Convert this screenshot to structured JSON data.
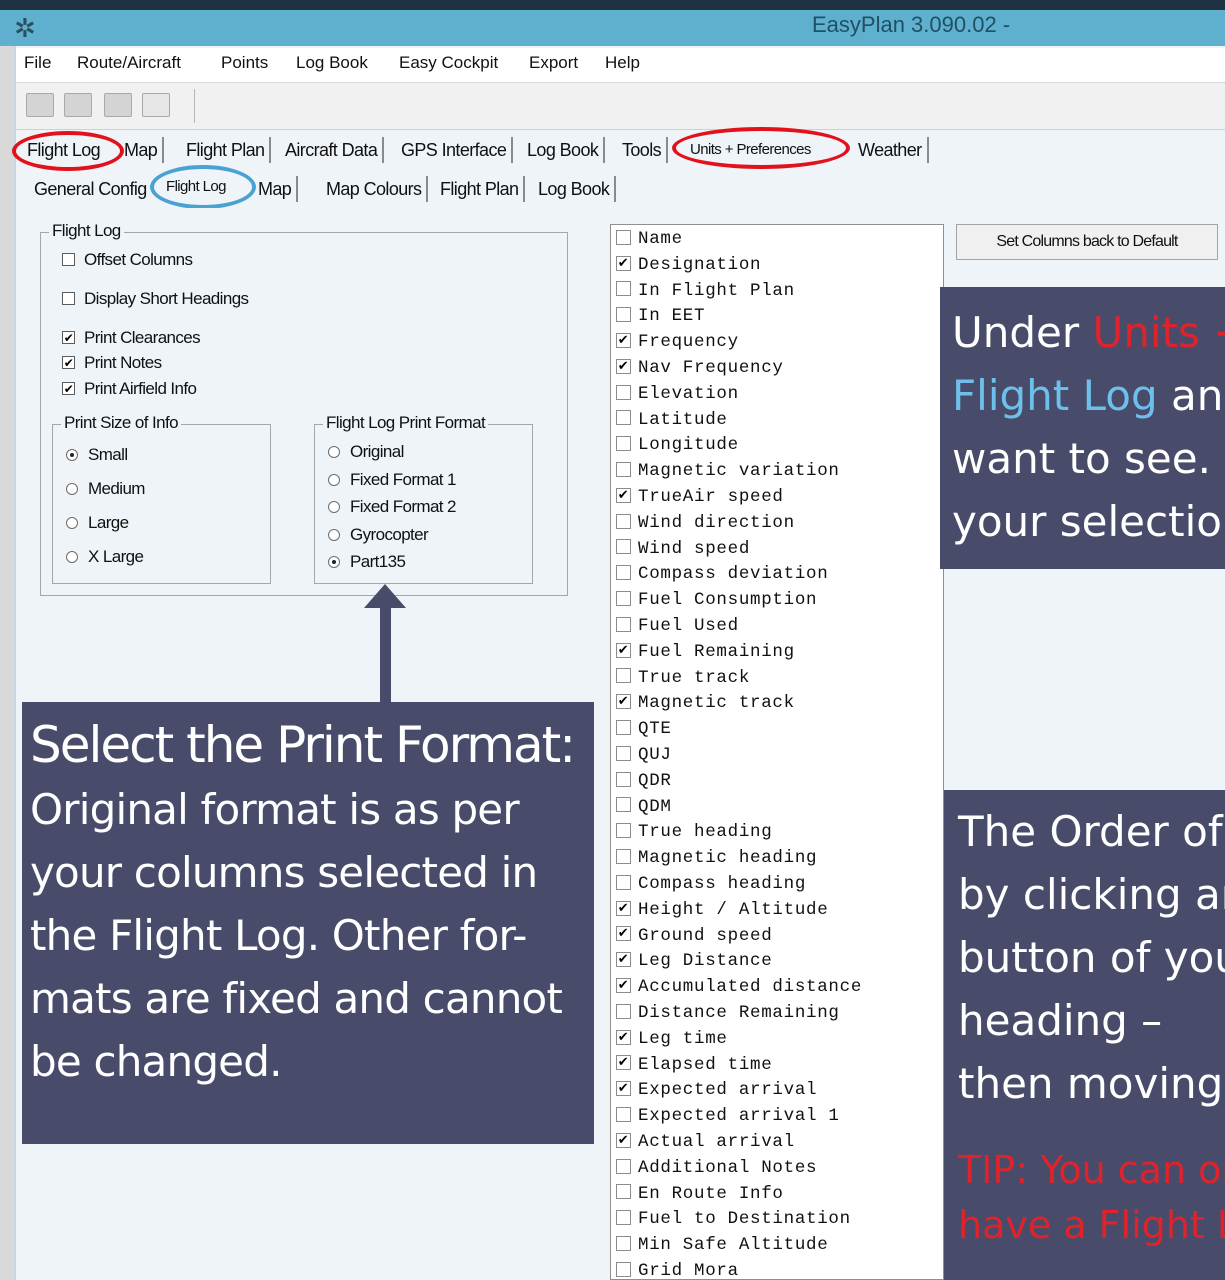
{
  "window": {
    "title": "EasyPlan 3.090.02 -",
    "icon": "easyplan-app-icon"
  },
  "menu": [
    "File",
    "Route/Aircraft",
    "Points",
    "Log Book",
    "Easy Cockpit",
    "Export",
    "Help"
  ],
  "toolbar": {
    "icons": [
      "open-icon",
      "save-icon",
      "print-icon",
      "print-preview-icon"
    ]
  },
  "main_tabs": [
    {
      "label": "Flight Log",
      "circled": "red"
    },
    {
      "label": "Map"
    },
    {
      "label": "Flight Plan"
    },
    {
      "label": "Aircraft Data"
    },
    {
      "label": "GPS Interface"
    },
    {
      "label": "Log Book"
    },
    {
      "label": "Tools"
    },
    {
      "label": "Units + Preferences",
      "circled": "red",
      "selected": true
    },
    {
      "label": "Weather"
    }
  ],
  "sub_tabs": [
    {
      "label": "General Config"
    },
    {
      "label": "Flight Log",
      "circled": "blue",
      "selected": true
    },
    {
      "label": "Map"
    },
    {
      "label": "Map Colours"
    },
    {
      "label": "Flight Plan"
    },
    {
      "label": "Log Book"
    }
  ],
  "flight_log_group": {
    "title": "Flight Log",
    "options": [
      {
        "label": "Offset Columns",
        "checked": false
      },
      {
        "label": "Display Short Headings",
        "checked": false
      },
      {
        "label": "Print Clearances",
        "checked": true
      },
      {
        "label": "Print Notes",
        "checked": true
      },
      {
        "label": "Print Airfield Info",
        "checked": true
      }
    ]
  },
  "print_size": {
    "title": "Print Size of Info",
    "options": [
      {
        "label": "Small",
        "selected": true
      },
      {
        "label": "Medium",
        "selected": false
      },
      {
        "label": "Large",
        "selected": false
      },
      {
        "label": "X Large",
        "selected": false
      }
    ]
  },
  "print_format": {
    "title": "Flight Log Print Format",
    "options": [
      {
        "label": "Original",
        "selected": false
      },
      {
        "label": "Fixed Format 1",
        "selected": false
      },
      {
        "label": "Fixed Format 2",
        "selected": false
      },
      {
        "label": "Gyrocopter",
        "selected": false
      },
      {
        "label": "Part135",
        "selected": true
      }
    ]
  },
  "columns": [
    {
      "label": "Name",
      "checked": false
    },
    {
      "label": "Designation",
      "checked": true
    },
    {
      "label": "In Flight Plan",
      "checked": false
    },
    {
      "label": "In EET",
      "checked": false
    },
    {
      "label": "Frequency",
      "checked": true
    },
    {
      "label": "Nav Frequency",
      "checked": true
    },
    {
      "label": "Elevation",
      "checked": false
    },
    {
      "label": "Latitude",
      "checked": false
    },
    {
      "label": "Longitude",
      "checked": false
    },
    {
      "label": "Magnetic variation",
      "checked": false
    },
    {
      "label": "TrueAir speed",
      "checked": true
    },
    {
      "label": "Wind direction",
      "checked": false
    },
    {
      "label": "Wind speed",
      "checked": false
    },
    {
      "label": "Compass deviation",
      "checked": false
    },
    {
      "label": "Fuel Consumption",
      "checked": false
    },
    {
      "label": "Fuel Used",
      "checked": false
    },
    {
      "label": "Fuel Remaining",
      "checked": true
    },
    {
      "label": "True track",
      "checked": false
    },
    {
      "label": "Magnetic track",
      "checked": true
    },
    {
      "label": "QTE",
      "checked": false
    },
    {
      "label": "QUJ",
      "checked": false
    },
    {
      "label": "QDR",
      "checked": false
    },
    {
      "label": "QDM",
      "checked": false
    },
    {
      "label": "True heading",
      "checked": false
    },
    {
      "label": "Magnetic heading",
      "checked": false
    },
    {
      "label": "Compass heading",
      "checked": false
    },
    {
      "label": "Height / Altitude",
      "checked": true
    },
    {
      "label": "Ground speed",
      "checked": true
    },
    {
      "label": "Leg Distance",
      "checked": true
    },
    {
      "label": "Accumulated distance",
      "checked": true
    },
    {
      "label": "Distance Remaining",
      "checked": false
    },
    {
      "label": "Leg time",
      "checked": true
    },
    {
      "label": "Elapsed time",
      "checked": true
    },
    {
      "label": "Expected arrival",
      "checked": true
    },
    {
      "label": "Expected arrival 1",
      "checked": false
    },
    {
      "label": "Actual arrival",
      "checked": true
    },
    {
      "label": "Additional Notes",
      "checked": false
    },
    {
      "label": "En Route Info",
      "checked": false
    },
    {
      "label": "Fuel to Destination",
      "checked": false
    },
    {
      "label": "Min Safe Altitude",
      "checked": false
    },
    {
      "label": "Grid Mora",
      "checked": false
    }
  ],
  "set_default_button": "Set Columns back to Default",
  "callout_left": {
    "heading": "Select the Print Format:",
    "lines": [
      "Original format is as per",
      "your columns selected in",
      "the Flight Log. Other for-",
      "mats are fixed and cannot",
      "be changed."
    ]
  },
  "callout_right_top": {
    "line1_prefix": "Under ",
    "line1_highlight": "Units +",
    "line2_highlight": "Flight Log",
    "line2_suffix": " and",
    "line3": "want to see.",
    "line4": "your selectio"
  },
  "callout_right_bottom": {
    "lines": [
      "The Order of",
      "by clicking ar",
      "button of you",
      "heading –",
      "then moving"
    ],
    "tip_lines": [
      "TIP: You can on",
      "have a Flight Lo"
    ]
  },
  "colors": {
    "callout_bg": "#484c6a",
    "highlight_red": "#e0222b",
    "highlight_blue": "#6ec0ec",
    "ring_red": "#e2121c",
    "ring_blue": "#4aa2d3"
  }
}
